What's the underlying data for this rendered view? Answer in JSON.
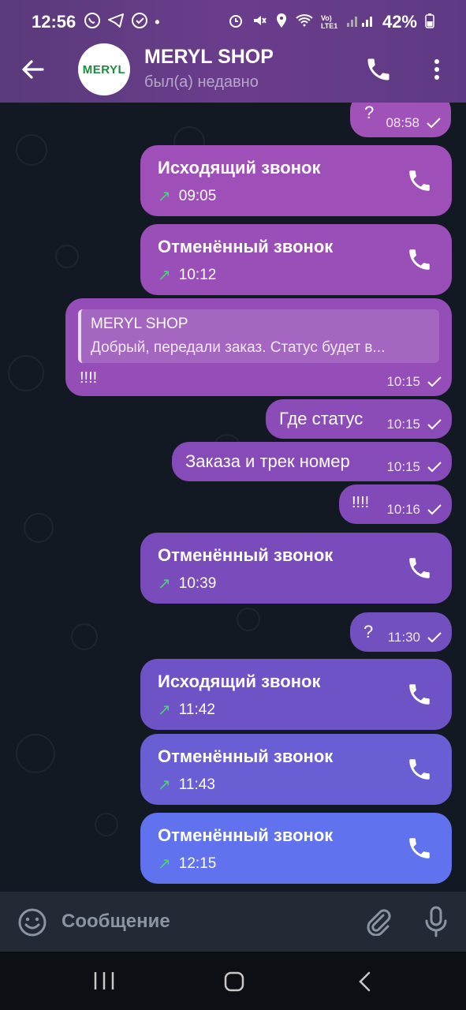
{
  "status_bar": {
    "time": "12:56",
    "battery": "42%",
    "network": "Vo) LTE1"
  },
  "header": {
    "avatar_text": "MERYL",
    "title": "MERYL SHOP",
    "subtitle": "был(а) недавно"
  },
  "messages": [
    {
      "type": "text",
      "text": "?",
      "time": "08:58"
    },
    {
      "type": "call",
      "title": "Исходящий звонок",
      "time": "09:05"
    },
    {
      "type": "call",
      "title": "Отменённый звонок",
      "time": "10:12"
    },
    {
      "type": "reply",
      "quote_name": "MERYL SHOP",
      "quote_text": "Добрый, передали заказ. Статус будет в...",
      "text": "!!!!",
      "time": "10:15"
    },
    {
      "type": "text",
      "text": "Где статус",
      "time": "10:15"
    },
    {
      "type": "text",
      "text": "Заказа и трек номер",
      "time": "10:15"
    },
    {
      "type": "text",
      "text": "!!!!",
      "time": "10:16"
    },
    {
      "type": "call",
      "title": "Отменённый звонок",
      "time": "10:39"
    },
    {
      "type": "text",
      "text": "?",
      "time": "11:30"
    },
    {
      "type": "call",
      "title": "Исходящий звонок",
      "time": "11:42"
    },
    {
      "type": "call",
      "title": "Отменённый звонок",
      "time": "11:43"
    },
    {
      "type": "call",
      "title": "Отменённый звонок",
      "time": "12:15"
    }
  ],
  "input": {
    "placeholder": "Сообщение"
  },
  "colors": {
    "bubble_top": "#a052b8",
    "bubble_bottom": "#6172ee",
    "call_arrow": "#4cd07a"
  }
}
